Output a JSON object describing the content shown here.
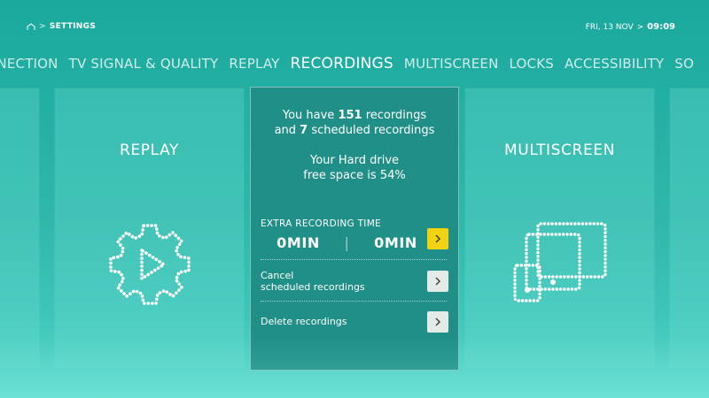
{
  "header": {
    "breadcrumb_separator": ">",
    "breadcrumb_title": "SETTINGS",
    "date": "FRI, 13 NOV",
    "clock_separator": ">",
    "time": "09:09"
  },
  "tabs": [
    {
      "label": "NNECTION"
    },
    {
      "label": "TV SIGNAL & QUALITY"
    },
    {
      "label": "REPLAY"
    },
    {
      "label": "RECORDINGS",
      "active": true
    },
    {
      "label": "MULTISCREEN"
    },
    {
      "label": "LOCKS"
    },
    {
      "label": "ACCESSIBILITY"
    },
    {
      "label": "SO"
    }
  ],
  "panels": {
    "replay": {
      "title": "REPLAY",
      "icon": "gear-play-icon"
    },
    "multiscreen": {
      "title": "MULTISCREEN",
      "icon": "multiscreen-devices-icon"
    }
  },
  "recordings": {
    "line1_prefix": "You have ",
    "recordings_count": "151",
    "line1_suffix": " recordings",
    "line2_prefix": "and ",
    "scheduled_count": "7",
    "line2_suffix": " scheduled recordings",
    "drive_line1": "Your Hard drive",
    "drive_line2": "free space is 54%",
    "extra_label": "EXTRA RECORDING TIME",
    "extra_before": "0MIN",
    "extra_separator": "|",
    "extra_after": "0MIN",
    "cancel_line1": "Cancel",
    "cancel_line2": "scheduled recordings",
    "delete_label": "Delete recordings"
  },
  "colors": {
    "background": "#1aa89d",
    "center_panel": "#208f87",
    "accent_button": "#f2d212",
    "light_button": "#e3ebe8"
  }
}
